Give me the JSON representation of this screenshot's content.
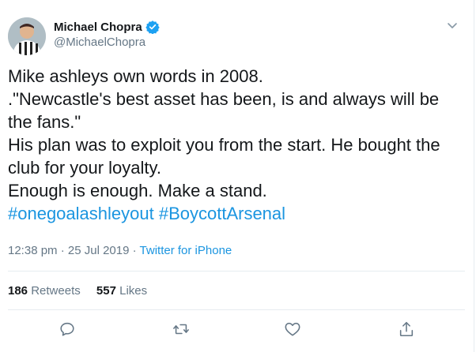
{
  "author": {
    "display_name": "Michael Chopra",
    "handle": "@MichaelChopra",
    "verified": true
  },
  "tweet": {
    "lines": [
      "Mike ashleys own words in 2008.",
      ".\"Newcastle's best asset has been, is and always will be",
      "the fans.\"",
      "His plan was to exploit you from the start. He bought the",
      "club for your loyalty.",
      "Enough is enough. Make a stand."
    ],
    "hashtags": [
      "#onegoalashleyout",
      "#BoycottArsenal"
    ]
  },
  "meta": {
    "time": "12:38 pm",
    "separator1": "·",
    "date": "25 Jul 2019",
    "separator2": "·",
    "source": "Twitter for iPhone"
  },
  "stats": {
    "retweets_count": "186",
    "retweets_label": "Retweets",
    "likes_count": "557",
    "likes_label": "Likes"
  },
  "actions": {
    "icons": [
      "reply-icon",
      "retweet-icon",
      "like-icon",
      "share-icon"
    ]
  },
  "colors": {
    "link": "#1b95e0",
    "muted": "#657786",
    "text": "#14171a",
    "divider": "#e6ecf0",
    "verified": "#1da1f2"
  }
}
